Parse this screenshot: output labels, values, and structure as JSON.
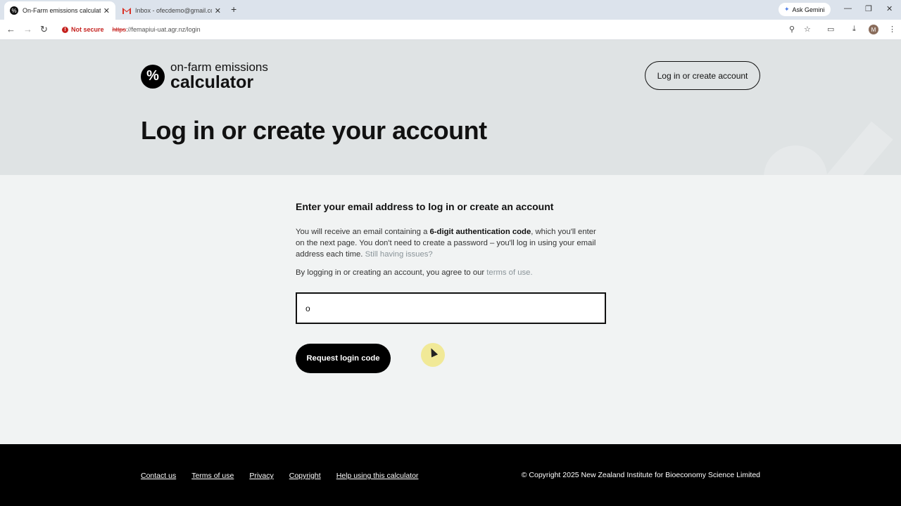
{
  "browser": {
    "tabs": [
      {
        "title": "On-Farm emissions calculator",
        "active": true
      },
      {
        "title": "Inbox - ofecdemo@gmail.com",
        "active": false
      }
    ],
    "new_tab_label": "+",
    "ask_gemini": "Ask Gemini",
    "security_label": "Not secure",
    "url_scheme": "https",
    "url_rest": "://femapiui-uat.agr.nz/login",
    "profile_initial": "M"
  },
  "header": {
    "logo_line1": "on-farm emissions",
    "logo_line2": "calculator",
    "login_button": "Log in or create account"
  },
  "hero": {
    "title": "Log in or create your account"
  },
  "form": {
    "heading": "Enter your email address to log in or create an account",
    "para_1": "You will receive an email containing a ",
    "para_bold": "6-digit authentication code",
    "para_2": ", which you'll enter on the next page. You don't need to create a password – you'll log in using your email address each time. ",
    "issues_link": "Still having issues?",
    "agree_text": "By logging in or creating an account, you agree to our ",
    "terms_link": "terms of use.",
    "email_value": "o",
    "submit_label": "Request login code"
  },
  "footer": {
    "links": [
      "Contact us",
      "Terms of use",
      "Privacy",
      "Copyright",
      "Help using this calculator"
    ],
    "copyright": "© Copyright 2025 New Zealand Institute for Bioeconomy Science Limited"
  },
  "colors": {
    "hero_bg": "#dfe3e4",
    "page_bg": "#f1f3f3",
    "footer_bg": "#000000",
    "link_muted": "#8a9499",
    "insecure_red": "#c5221f"
  }
}
